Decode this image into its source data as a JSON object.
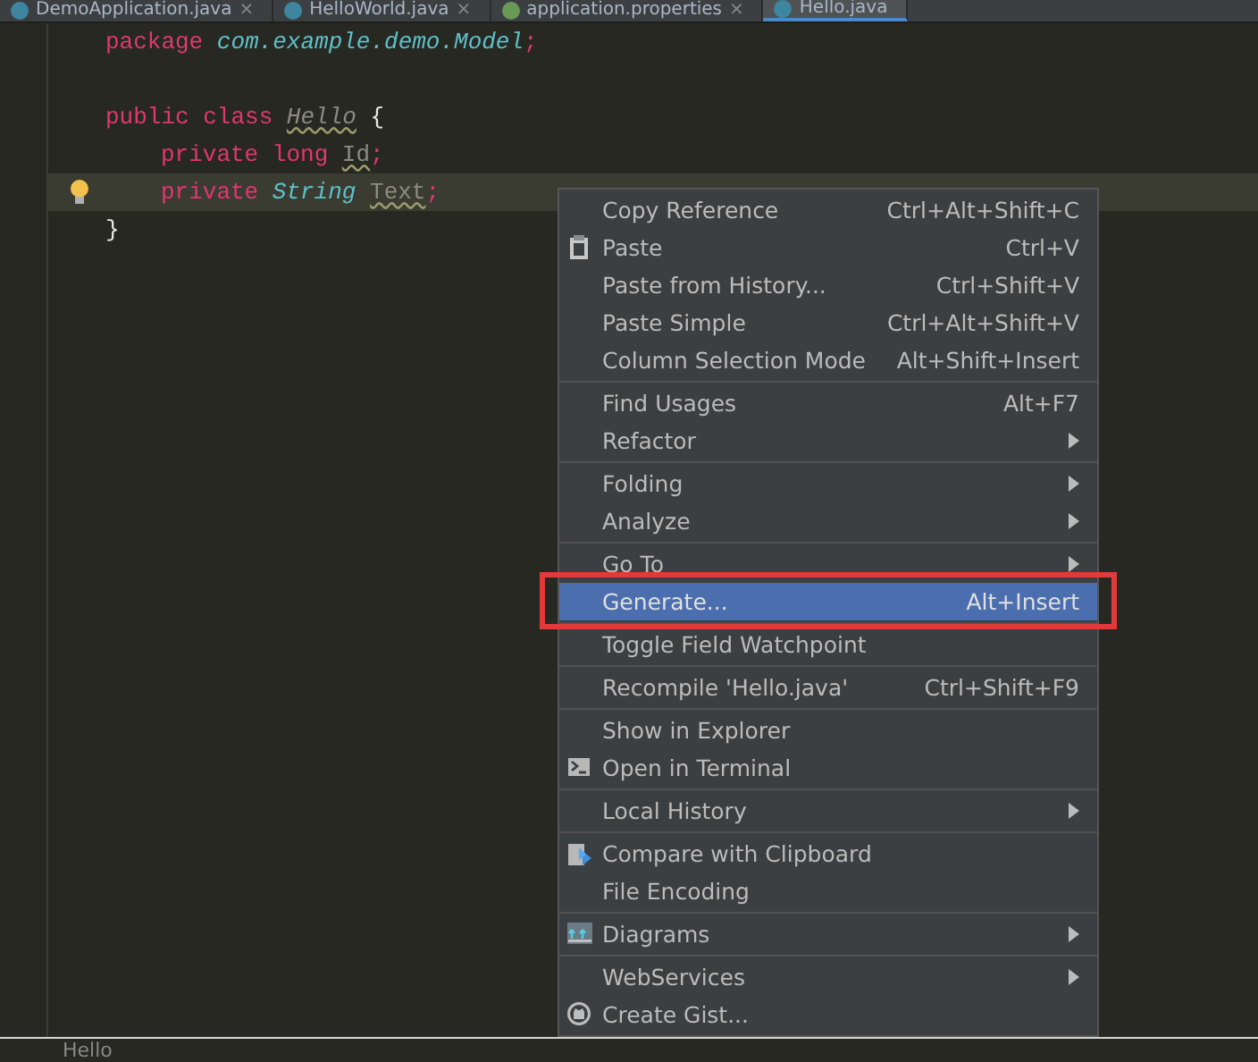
{
  "tabs": [
    {
      "label": "DemoApplication.java",
      "close": "×",
      "kind": "class",
      "selected": false
    },
    {
      "label": "HelloWorld.java",
      "close": "×",
      "kind": "class",
      "selected": false
    },
    {
      "label": "application.properties",
      "close": "×",
      "kind": "properties",
      "selected": false
    },
    {
      "label": "Hello.java",
      "kind": "class",
      "selected": true
    }
  ],
  "code": [
    {
      "current": false,
      "indented": false,
      "bulb": false,
      "tokens": [
        {
          "kind": "keyword",
          "text": "package"
        },
        {
          "kind": "package",
          "text": "com.example.demo.Model"
        },
        {
          "kind": "keyword",
          "text": ";",
          "joined": true
        }
      ]
    },
    {
      "current": false,
      "bulb": false
    },
    {
      "current": false,
      "indented": false,
      "bulb": false,
      "tokens": [
        {
          "kind": "keyword",
          "text": "public class"
        },
        {
          "kind": "unused_class",
          "text": "Hello"
        },
        {
          "kind": "plain",
          "text": "{"
        }
      ]
    },
    {
      "current": false,
      "indented": true,
      "bulb": false,
      "tokens": [
        {
          "kind": "keyword",
          "text": "private long"
        },
        {
          "kind": "unused",
          "text": "Id"
        },
        {
          "kind": "keyword",
          "text": ";",
          "joined": true
        }
      ]
    },
    {
      "current": true,
      "indented": true,
      "bulb": true,
      "tokens": [
        {
          "kind": "keyword",
          "text": "private"
        },
        {
          "kind": "type",
          "text": "String"
        },
        {
          "kind": "unused",
          "text": "Text"
        },
        {
          "kind": "keyword",
          "text": ";",
          "joined": true
        }
      ]
    },
    {
      "current": false,
      "indented": false,
      "bulb": false,
      "tokens": [
        {
          "kind": "plain",
          "text": "}"
        }
      ]
    }
  ],
  "menu": [
    [
      {
        "label": "Copy Reference",
        "shortcut": "Ctrl+Alt+Shift+C",
        "submenu": false,
        "selected": false
      },
      {
        "label": "Paste",
        "shortcut": "Ctrl+V",
        "kind": "clipboard",
        "submenu": false,
        "selected": false
      },
      {
        "label": "Paste from History...",
        "shortcut": "Ctrl+Shift+V",
        "submenu": false,
        "selected": false
      },
      {
        "label": "Paste Simple",
        "shortcut": "Ctrl+Alt+Shift+V",
        "submenu": false,
        "selected": false
      },
      {
        "label": "Column Selection Mode",
        "shortcut": "Alt+Shift+Insert",
        "submenu": false,
        "selected": false
      }
    ],
    [
      {
        "label": "Find Usages",
        "shortcut": "Alt+F7",
        "submenu": false,
        "selected": false
      },
      {
        "label": "Refactor",
        "submenu": true,
        "selected": false
      }
    ],
    [
      {
        "label": "Folding",
        "submenu": true,
        "selected": false
      },
      {
        "label": "Analyze",
        "submenu": true,
        "selected": false
      }
    ],
    [
      {
        "label": "Go To",
        "submenu": true,
        "selected": false
      },
      {
        "label": "Generate...",
        "shortcut": "Alt+Insert",
        "submenu": false,
        "selected": true,
        "annotated": true
      }
    ],
    [
      {
        "label": "Toggle Field Watchpoint",
        "submenu": false,
        "selected": false
      }
    ],
    [
      {
        "label": "Recompile 'Hello.java'",
        "shortcut": "Ctrl+Shift+F9",
        "submenu": false,
        "selected": false
      }
    ],
    [
      {
        "label": "Show in Explorer",
        "submenu": false,
        "selected": false
      },
      {
        "label": "Open in Terminal",
        "kind": "terminal",
        "submenu": false,
        "selected": false
      }
    ],
    [
      {
        "label": "Local History",
        "submenu": true,
        "selected": false
      }
    ],
    [
      {
        "label": "Compare with Clipboard",
        "kind": "compare",
        "submenu": false,
        "selected": false
      },
      {
        "label": "File Encoding",
        "submenu": false,
        "selected": false
      }
    ],
    [
      {
        "label": "Diagrams",
        "kind": "diagram",
        "submenu": true,
        "selected": false
      }
    ],
    [
      {
        "label": "WebServices",
        "submenu": true,
        "selected": false
      },
      {
        "label": "Create Gist...",
        "kind": "gist",
        "submenu": false,
        "selected": false
      }
    ]
  ],
  "breadcrumb": "Hello"
}
